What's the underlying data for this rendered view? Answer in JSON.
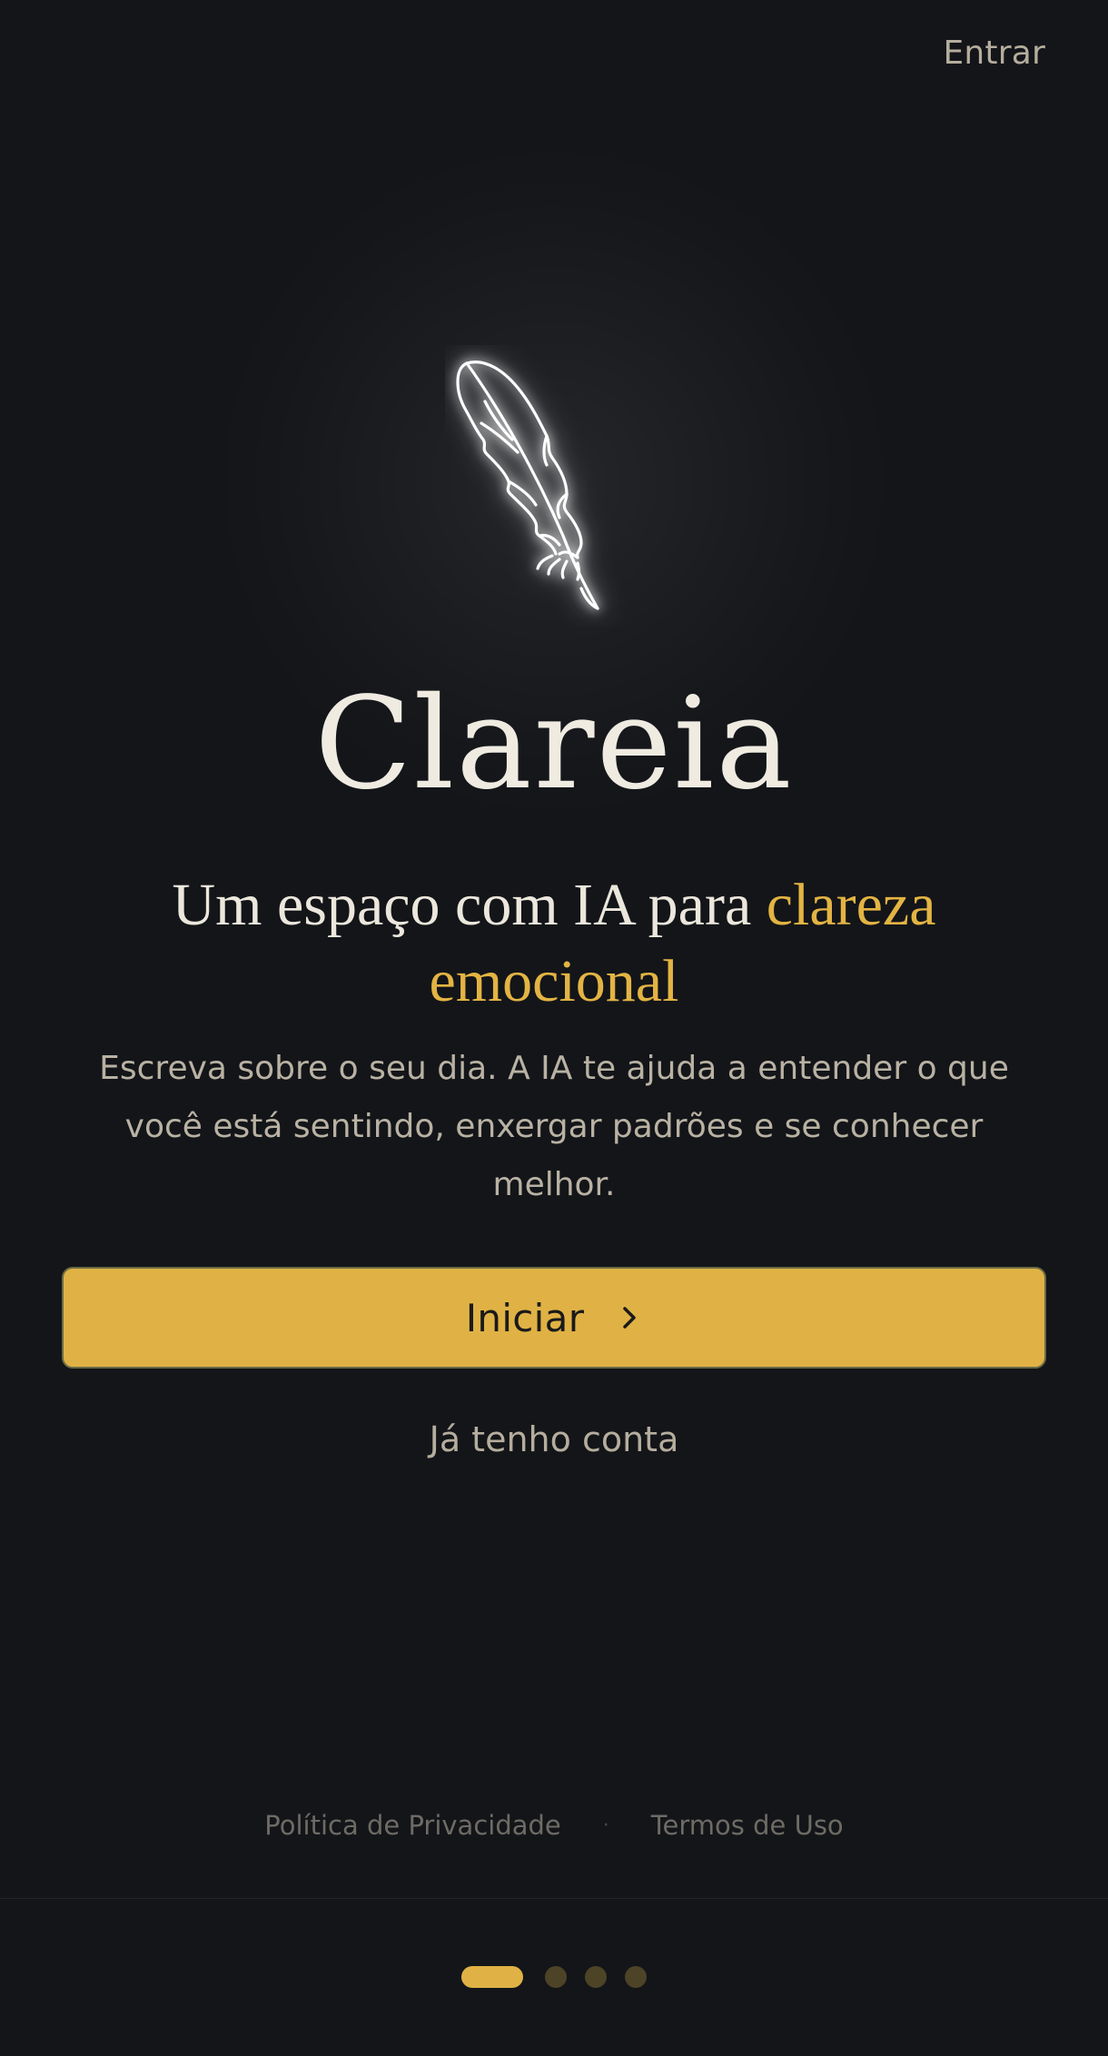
{
  "header": {
    "login_link": "Entrar"
  },
  "hero": {
    "icon": "feather-icon",
    "brand_name": "Clareia",
    "headline_prefix": "Um espaço com IA para ",
    "headline_accent": "clareza emocional",
    "description": "Escreva sobre o seu dia. A IA te ajuda a entender o que você está sentindo, enxergar padrões e se conhecer melhor."
  },
  "actions": {
    "start_label": "Iniciar",
    "start_icon": "chevron-right-icon",
    "existing_account_label": "Já tenho conta"
  },
  "footer": {
    "privacy_link": "Política de Privacidade",
    "separator": "·",
    "terms_link": "Termos de Uso"
  },
  "pager": {
    "total_pages": 4,
    "current_page": 1
  },
  "colors": {
    "background": "#131519",
    "accent": "#e0b245",
    "text_primary": "#efebe1",
    "text_secondary": "#b5ad9d",
    "text_muted": "#6e6b65"
  }
}
